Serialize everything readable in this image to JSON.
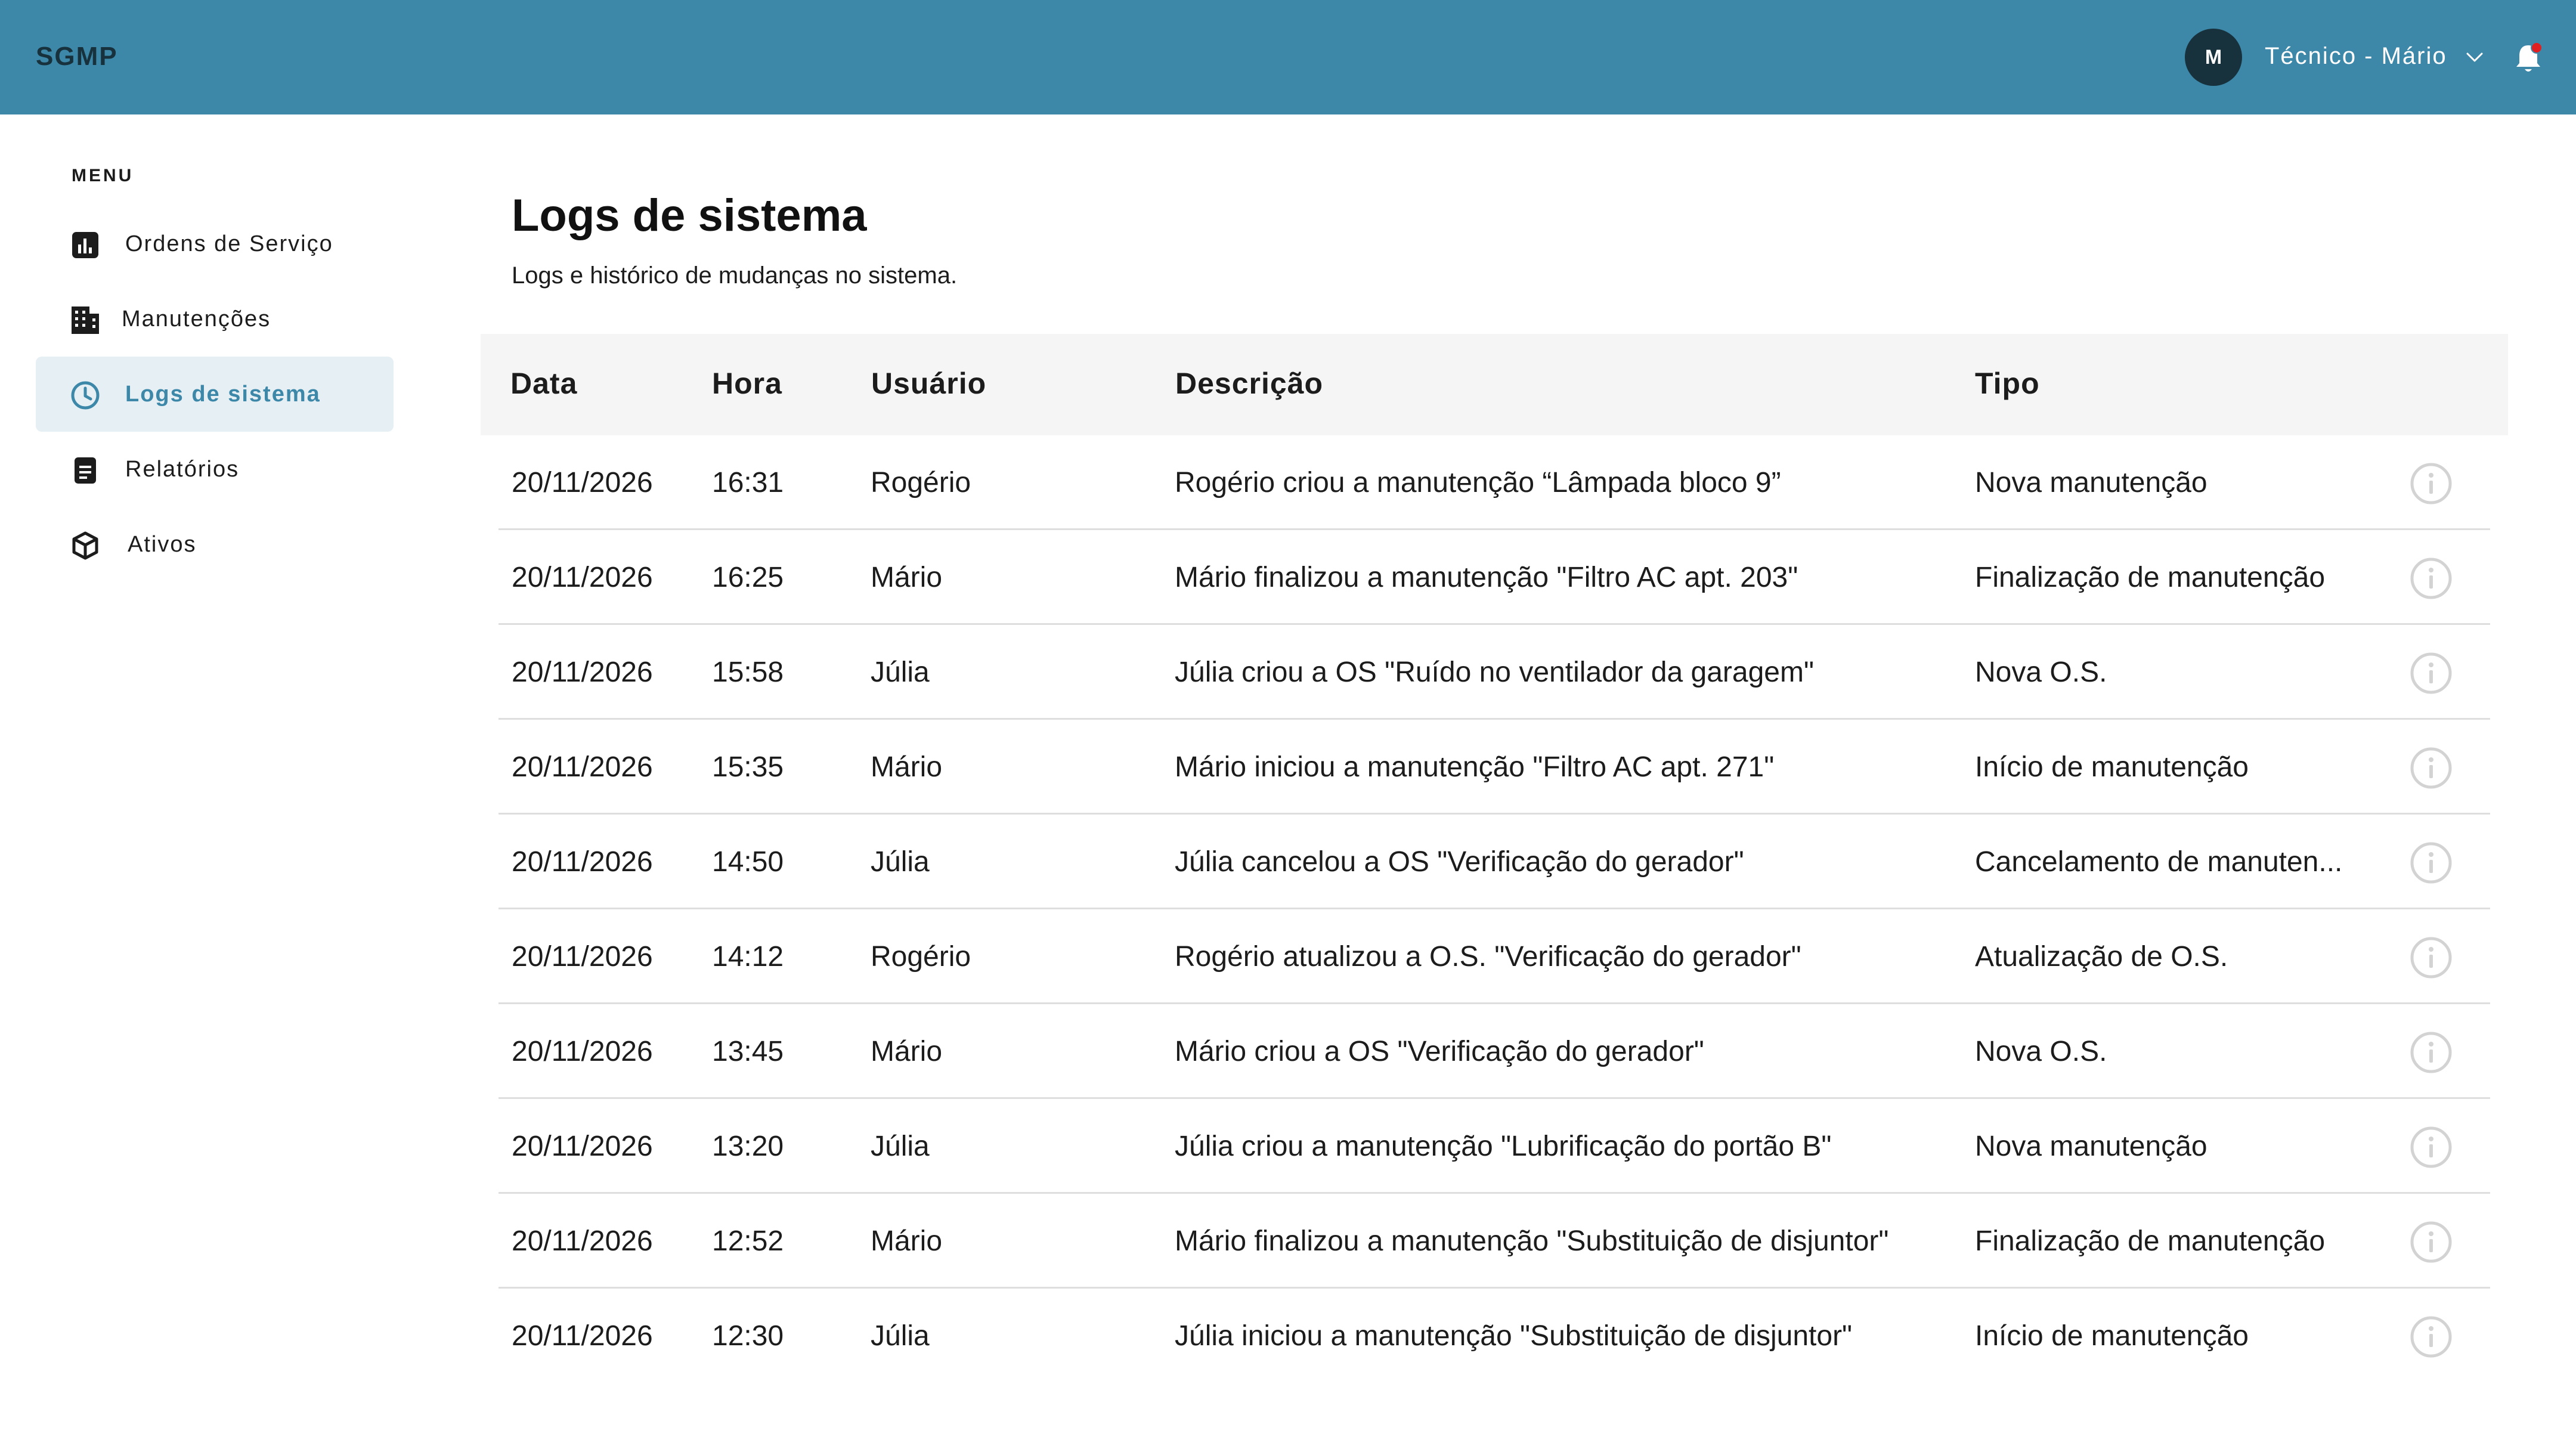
{
  "brand": "SGMP",
  "user": {
    "initial": "M",
    "name": "Técnico - Mário"
  },
  "sidebar": {
    "title": "MENU",
    "items": [
      {
        "label": "Ordens de Serviço",
        "icon": "chart-icon"
      },
      {
        "label": "Manutenções",
        "icon": "building-icon"
      },
      {
        "label": "Logs de sistema",
        "icon": "clock-icon",
        "active": true
      },
      {
        "label": "Relatórios",
        "icon": "report-icon"
      },
      {
        "label": "Ativos",
        "icon": "cube-icon"
      }
    ]
  },
  "page": {
    "title": "Logs de sistema",
    "subtitle": "Logs e histórico de mudanças no sistema."
  },
  "table": {
    "headers": [
      "Data",
      "Hora",
      "Usuário",
      "Descrição",
      "Tipo"
    ],
    "rows": [
      {
        "data": "20/11/2026",
        "hora": "16:31",
        "usuario": "Rogério",
        "descricao": "Rogério criou a manutenção “Lâmpada bloco 9”",
        "tipo": "Nova manutenção"
      },
      {
        "data": "20/11/2026",
        "hora": "16:25",
        "usuario": "Mário",
        "descricao": "Mário finalizou a manutenção \"Filtro AC apt. 203\"",
        "tipo": "Finalização de manutenção"
      },
      {
        "data": "20/11/2026",
        "hora": "15:58",
        "usuario": "Júlia",
        "descricao": "Júlia criou a OS \"Ruído no ventilador da garagem\"",
        "tipo": "Nova O.S."
      },
      {
        "data": "20/11/2026",
        "hora": "15:35",
        "usuario": "Mário",
        "descricao": "Mário iniciou a manutenção \"Filtro AC apt. 271\"",
        "tipo": "Início de manutenção"
      },
      {
        "data": "20/11/2026",
        "hora": "14:50",
        "usuario": "Júlia",
        "descricao": "Júlia cancelou a OS \"Verificação do gerador\"",
        "tipo": "Cancelamento de manuten..."
      },
      {
        "data": "20/11/2026",
        "hora": "14:12",
        "usuario": "Rogério",
        "descricao": "Rogério atualizou a O.S. \"Verificação do gerador\"",
        "tipo": "Atualização de O.S."
      },
      {
        "data": "20/11/2026",
        "hora": "13:45",
        "usuario": "Mário",
        "descricao": "Mário criou a OS \"Verificação do gerador\"",
        "tipo": "Nova O.S."
      },
      {
        "data": "20/11/2026",
        "hora": "13:20",
        "usuario": "Júlia",
        "descricao": "Júlia criou a manutenção \"Lubrificação do portão B\"",
        "tipo": "Nova manutenção"
      },
      {
        "data": "20/11/2026",
        "hora": "12:52",
        "usuario": "Mário",
        "descricao": "Mário finalizou a manutenção \"Substituição de disjuntor\"",
        "tipo": "Finalização de manutenção"
      },
      {
        "data": "20/11/2026",
        "hora": "12:30",
        "usuario": "Júlia",
        "descricao": "Júlia iniciou a manutenção \"Substituição de disjuntor\"",
        "tipo": "Início de manutenção"
      }
    ]
  },
  "colors": {
    "topbar": "#3d88a8",
    "accent": "#3d88a8",
    "dark": "#17313d",
    "notification": "#e02020"
  }
}
